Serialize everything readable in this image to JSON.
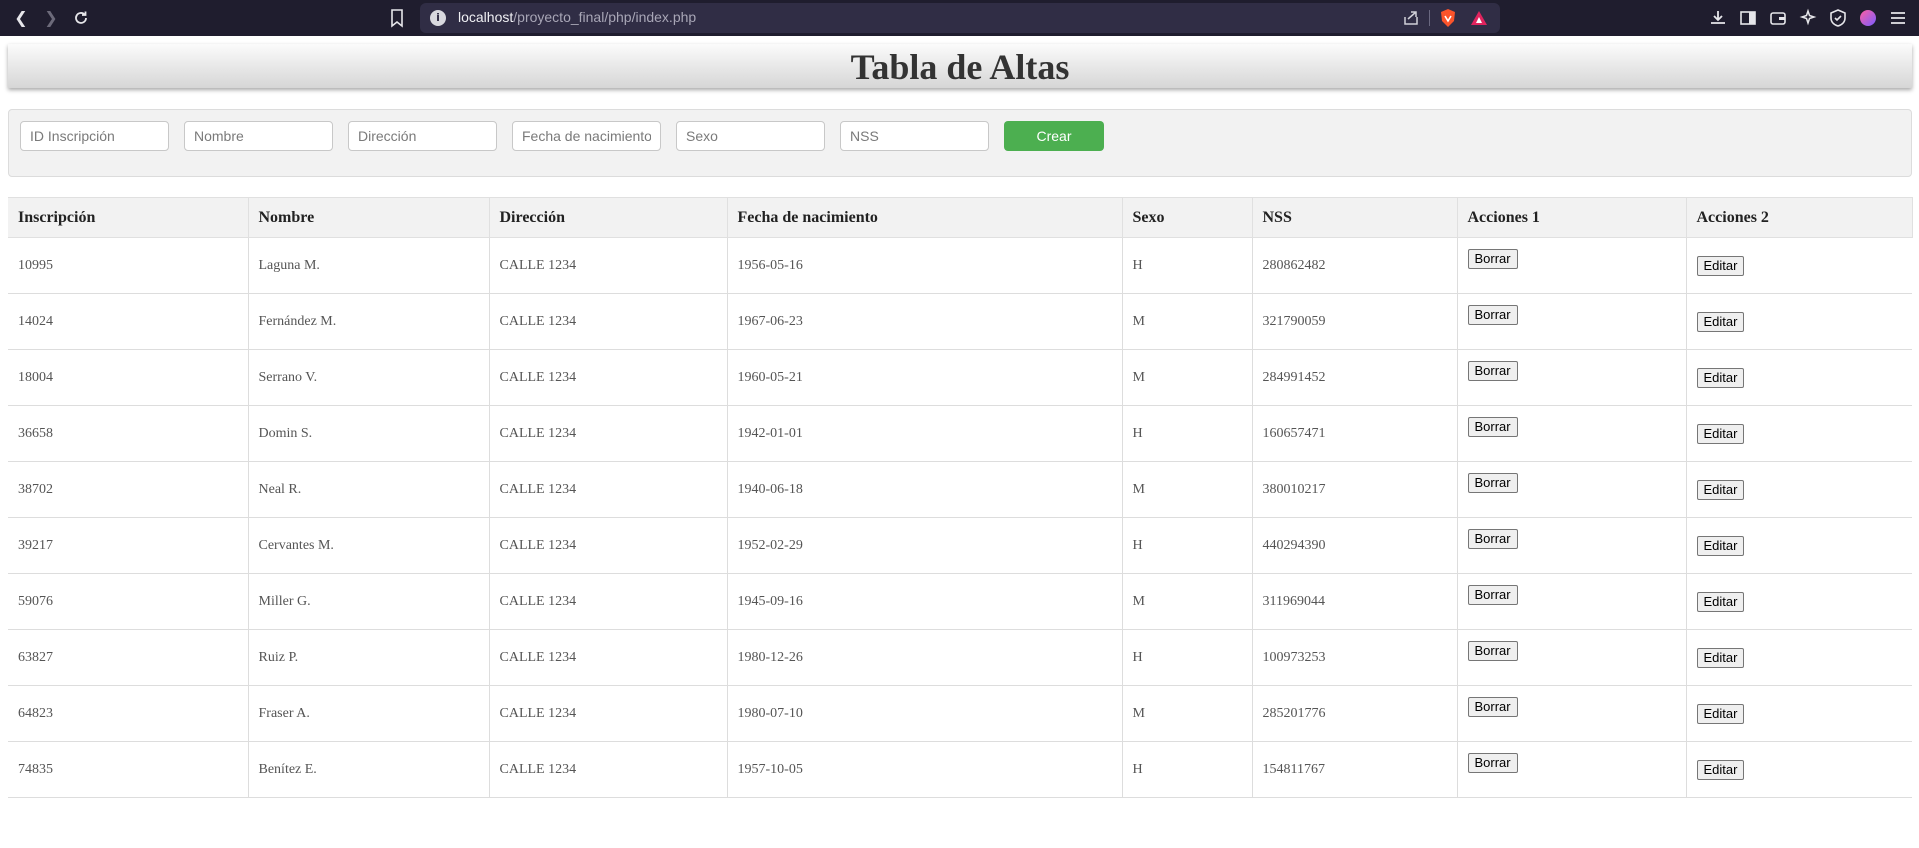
{
  "browser": {
    "url_host": "localhost",
    "url_path": "/proyecto_final/php/index.php"
  },
  "page": {
    "title": "Tabla de Altas"
  },
  "form": {
    "fields": [
      {
        "name": "id-inscripcion-input",
        "placeholder": "ID Inscripción"
      },
      {
        "name": "nombre-input",
        "placeholder": "Nombre"
      },
      {
        "name": "direccion-input",
        "placeholder": "Dirección"
      },
      {
        "name": "fecha-nacimiento-input",
        "placeholder": "Fecha de nacimiento"
      },
      {
        "name": "sexo-input",
        "placeholder": "Sexo"
      },
      {
        "name": "nss-input",
        "placeholder": "NSS"
      }
    ],
    "submit_label": "Crear",
    "submit_color": "#4caf50"
  },
  "table": {
    "headers": [
      "Inscripción",
      "Nombre",
      "Dirección",
      "Fecha de nacimiento",
      "Sexo",
      "NSS",
      "Acciones 1",
      "Acciones 2"
    ],
    "delete_label": "Borrar",
    "edit_label": "Editar",
    "rows": [
      {
        "inscripcion": "10995",
        "nombre": "Laguna M.",
        "direccion": "CALLE 1234",
        "fecha": "1956-05-16",
        "sexo": "H",
        "nss": "280862482"
      },
      {
        "inscripcion": "14024",
        "nombre": "Fernández M.",
        "direccion": "CALLE 1234",
        "fecha": "1967-06-23",
        "sexo": "M",
        "nss": "321790059"
      },
      {
        "inscripcion": "18004",
        "nombre": "Serrano V.",
        "direccion": "CALLE 1234",
        "fecha": "1960-05-21",
        "sexo": "M",
        "nss": "284991452"
      },
      {
        "inscripcion": "36658",
        "nombre": "Domin S.",
        "direccion": "CALLE 1234",
        "fecha": "1942-01-01",
        "sexo": "H",
        "nss": "160657471"
      },
      {
        "inscripcion": "38702",
        "nombre": "Neal R.",
        "direccion": "CALLE 1234",
        "fecha": "1940-06-18",
        "sexo": "M",
        "nss": "380010217"
      },
      {
        "inscripcion": "39217",
        "nombre": "Cervantes M.",
        "direccion": "CALLE 1234",
        "fecha": "1952-02-29",
        "sexo": "H",
        "nss": "440294390"
      },
      {
        "inscripcion": "59076",
        "nombre": "Miller G.",
        "direccion": "CALLE 1234",
        "fecha": "1945-09-16",
        "sexo": "M",
        "nss": "311969044"
      },
      {
        "inscripcion": "63827",
        "nombre": "Ruiz P.",
        "direccion": "CALLE 1234",
        "fecha": "1980-12-26",
        "sexo": "H",
        "nss": "100973253"
      },
      {
        "inscripcion": "64823",
        "nombre": "Fraser A.",
        "direccion": "CALLE 1234",
        "fecha": "1980-07-10",
        "sexo": "M",
        "nss": "285201776"
      },
      {
        "inscripcion": "74835",
        "nombre": "Benítez E.",
        "direccion": "CALLE 1234",
        "fecha": "1957-10-05",
        "sexo": "H",
        "nss": "154811767"
      }
    ]
  }
}
